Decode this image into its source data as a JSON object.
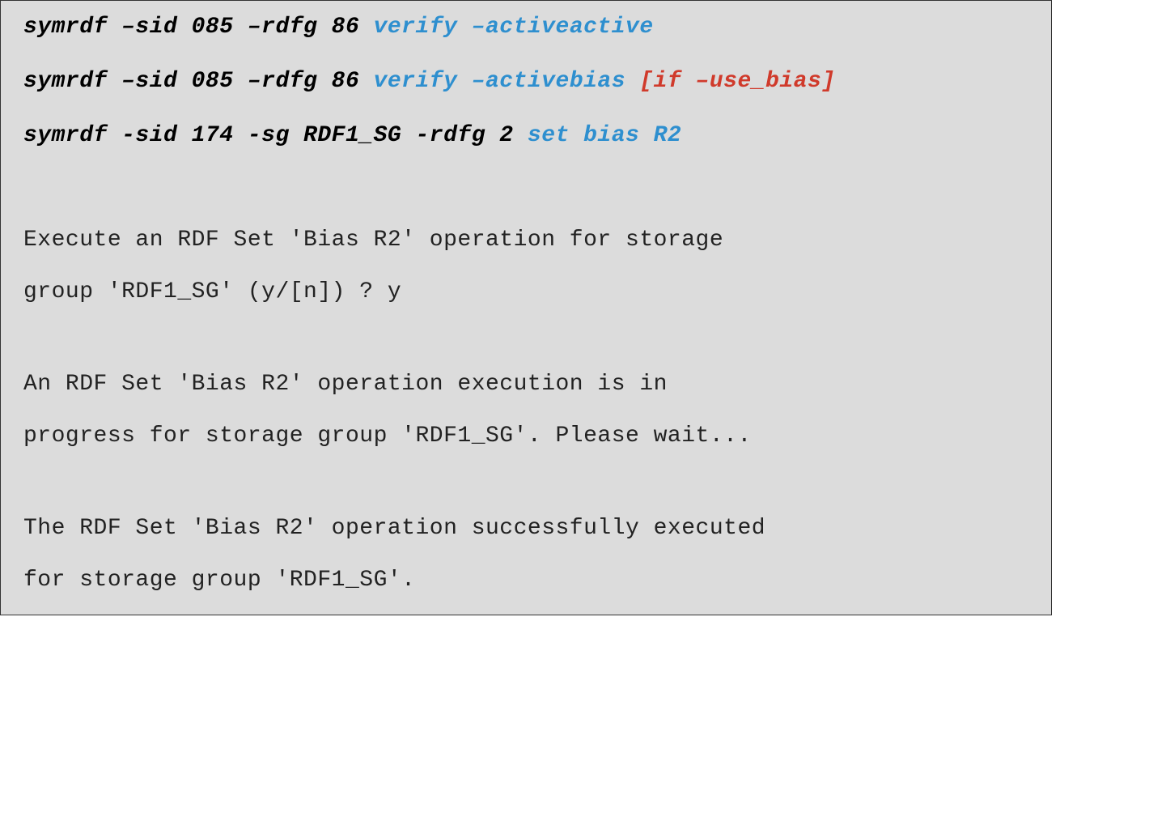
{
  "commands": {
    "cmd1": {
      "prefix": "symrdf –sid 085 –rdfg 86 ",
      "action": "verify –activeactive"
    },
    "cmd2": {
      "prefix": "symrdf –sid 085 –rdfg 86 ",
      "action": "verify –activebias ",
      "note": "[if –use_bias]"
    },
    "cmd3": {
      "prefix": "symrdf -sid 174 -sg RDF1_SG -rdfg 2 ",
      "action": "set bias R2"
    }
  },
  "output": {
    "group1": {
      "line1": "Execute an RDF Set 'Bias R2' operation for storage",
      "line2": "group 'RDF1_SG' (y/[n]) ? y"
    },
    "group2": {
      "line1": "An RDF Set 'Bias R2' operation execution is in",
      "line2": "progress for storage group 'RDF1_SG'. Please wait..."
    },
    "group3": {
      "line1": "The RDF Set 'Bias R2' operation successfully executed",
      "line2": "for storage group 'RDF1_SG'."
    }
  }
}
